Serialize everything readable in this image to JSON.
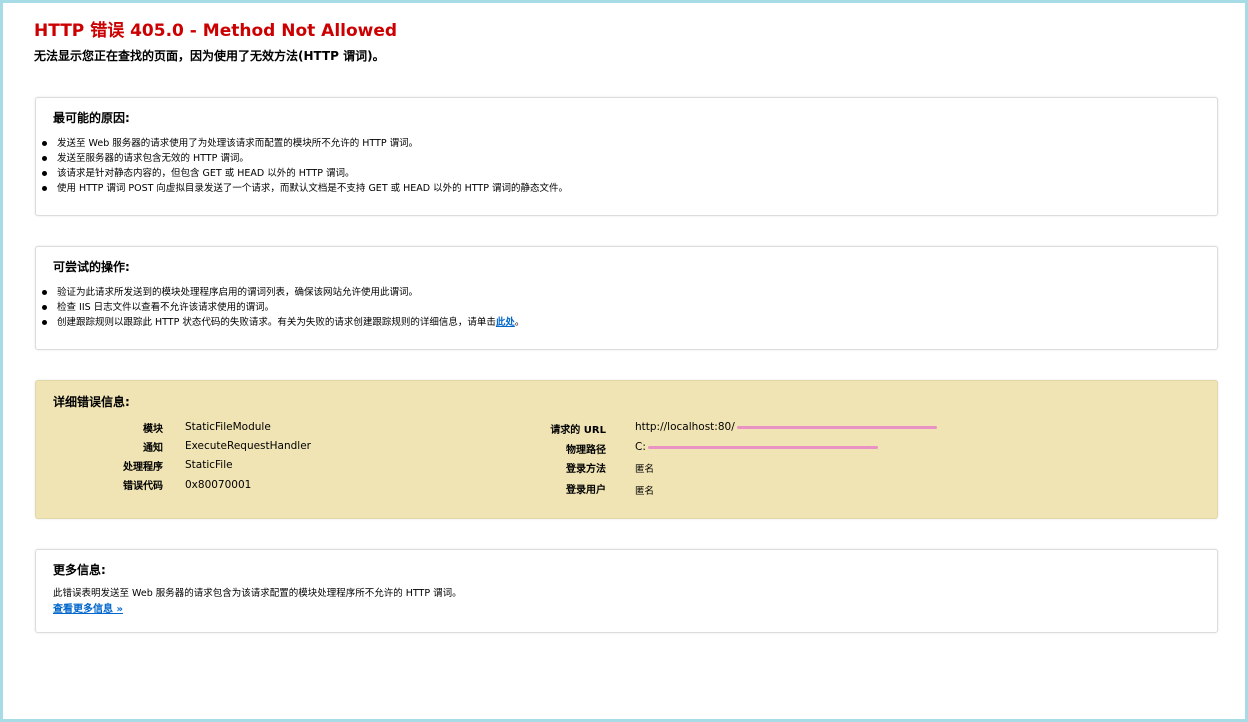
{
  "header": {
    "title": "HTTP 错误 405.0 - Method Not Allowed",
    "subtitle": "无法显示您正在查找的页面，因为使用了无效方法(HTTP 谓词)。"
  },
  "causes": {
    "heading": "最可能的原因:",
    "items": [
      "发送至 Web 服务器的请求使用了为处理该请求而配置的模块所不允许的 HTTP 谓词。",
      "发送至服务器的请求包含无效的 HTTP 谓词。",
      "该请求是针对静态内容的，但包含 GET 或 HEAD 以外的 HTTP 谓词。",
      "使用 HTTP 谓词 POST 向虚拟目录发送了一个请求，而默认文档是不支持 GET 或 HEAD 以外的 HTTP 谓词的静态文件。"
    ]
  },
  "actions": {
    "heading": "可尝试的操作:",
    "items": [
      "验证为此请求所发送到的模块处理程序启用的谓词列表，确保该网站允许使用此谓词。",
      "检查 IIS 日志文件以查看不允许该请求使用的谓词。"
    ],
    "item3_prefix": "创建跟踪规则以跟踪此 HTTP 状态代码的失败请求。有关为失败的请求创建跟踪规则的详细信息，请单击",
    "item3_link": "此处",
    "item3_suffix": "。"
  },
  "details": {
    "heading": "详细错误信息:",
    "left": [
      {
        "label": "模块",
        "value": "StaticFileModule"
      },
      {
        "label": "通知",
        "value": "ExecuteRequestHandler"
      },
      {
        "label": "处理程序",
        "value": "StaticFile"
      },
      {
        "label": "错误代码",
        "value": "0x80070001"
      }
    ],
    "right": [
      {
        "label": "请求的 URL",
        "value": "http://localhost:80/"
      },
      {
        "label": "物理路径",
        "value": "C:"
      },
      {
        "label": "登录方法",
        "value": "匿名"
      },
      {
        "label": "登录用户",
        "value": "匿名"
      }
    ]
  },
  "more": {
    "heading": "更多信息:",
    "text": "此错误表明发送至 Web 服务器的请求包含为该请求配置的模块处理程序所不允许的 HTTP 谓词。",
    "link": "查看更多信息 »"
  },
  "colors": {
    "title": "#cc0000",
    "detail_background": "#f0e4b4",
    "link": "#0066cc",
    "frame": "#a7dbe6",
    "redaction": "#e992c4"
  }
}
